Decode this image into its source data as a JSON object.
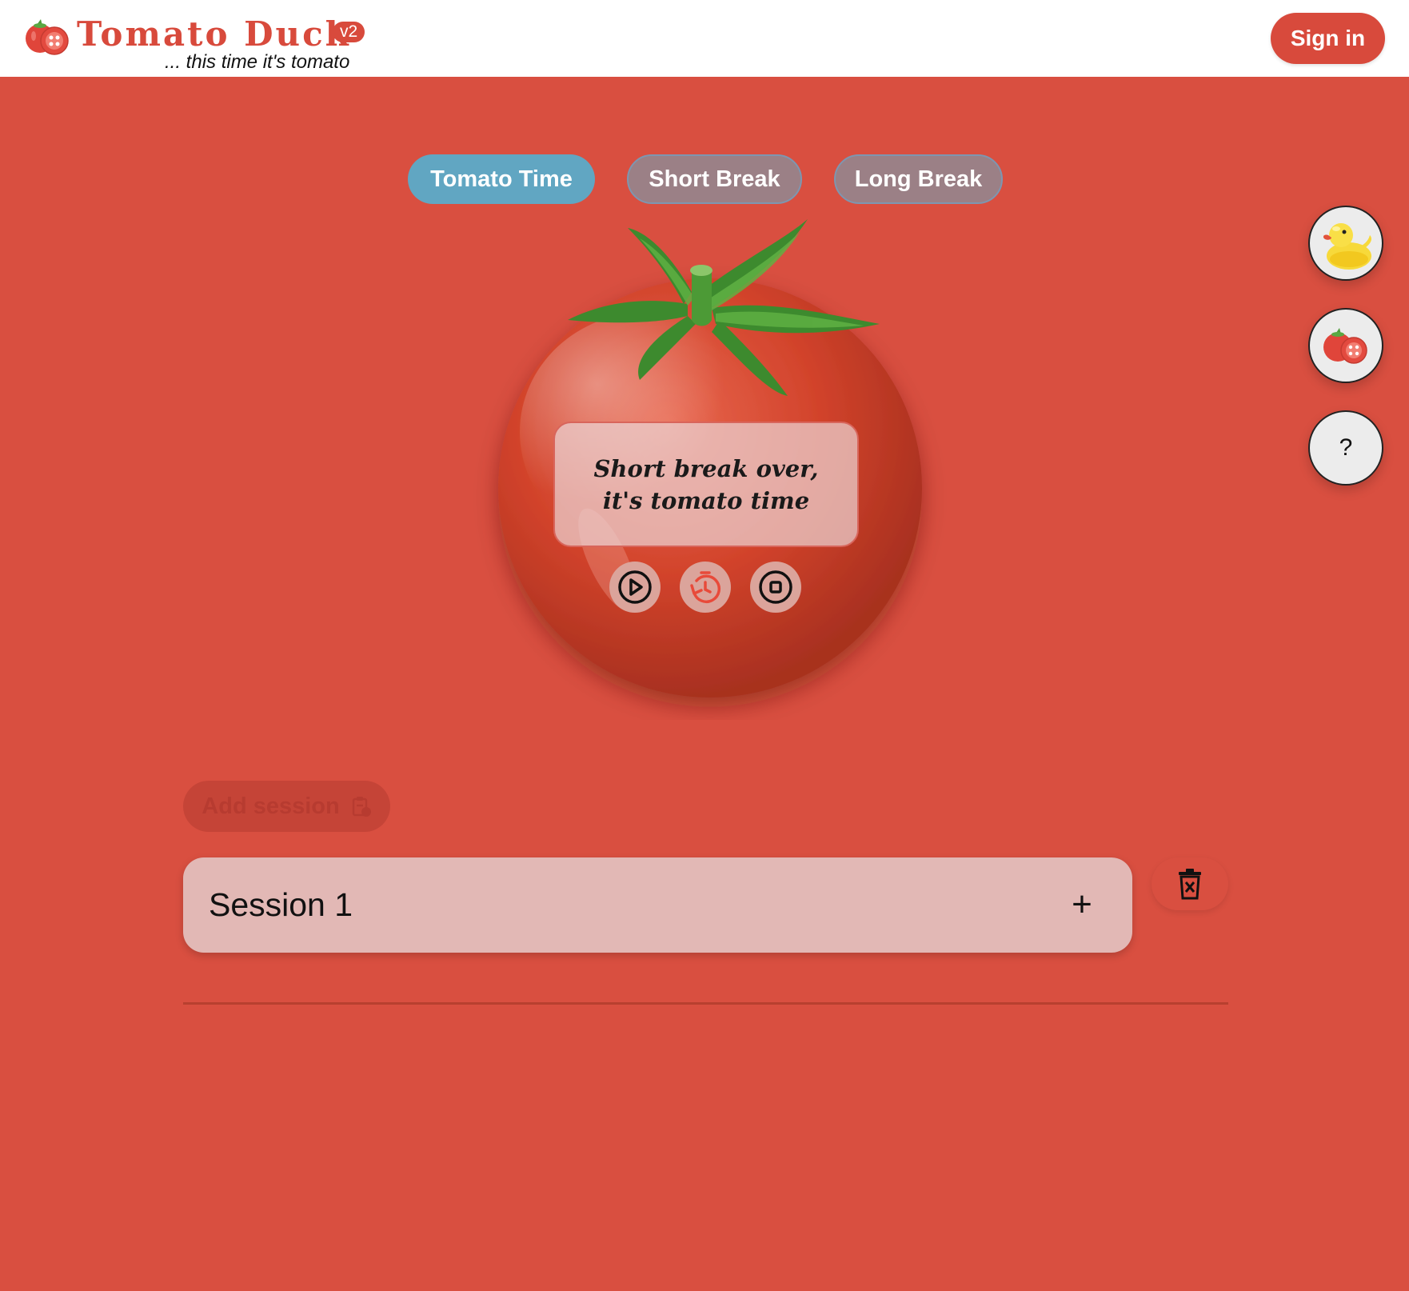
{
  "header": {
    "brand": "Tomato Duck",
    "version": "v2",
    "tagline": "... this time it's tomato",
    "signin_label": "Sign in"
  },
  "modes": {
    "tomato_time": "Tomato Time",
    "short_break": "Short Break",
    "long_break": "Long Break",
    "active": "Tomato Time"
  },
  "timer": {
    "message": "Short break over, it's tomato time",
    "controls": [
      "play-icon",
      "reset-timer-icon",
      "stop-icon"
    ]
  },
  "side": {
    "duck_icon": "duck-icon",
    "tomato_icon": "tomato-icon",
    "help_label": "?"
  },
  "sessions": {
    "add_label": "Add session",
    "items": [
      {
        "title": "Session 1",
        "add_symbol": "+"
      }
    ]
  },
  "colors": {
    "background": "#d94f40",
    "brand": "#d84a3c",
    "active_pill": "#61a6c2",
    "inactive_pill": "#9b8086",
    "session_card": "#e2b8b5"
  }
}
